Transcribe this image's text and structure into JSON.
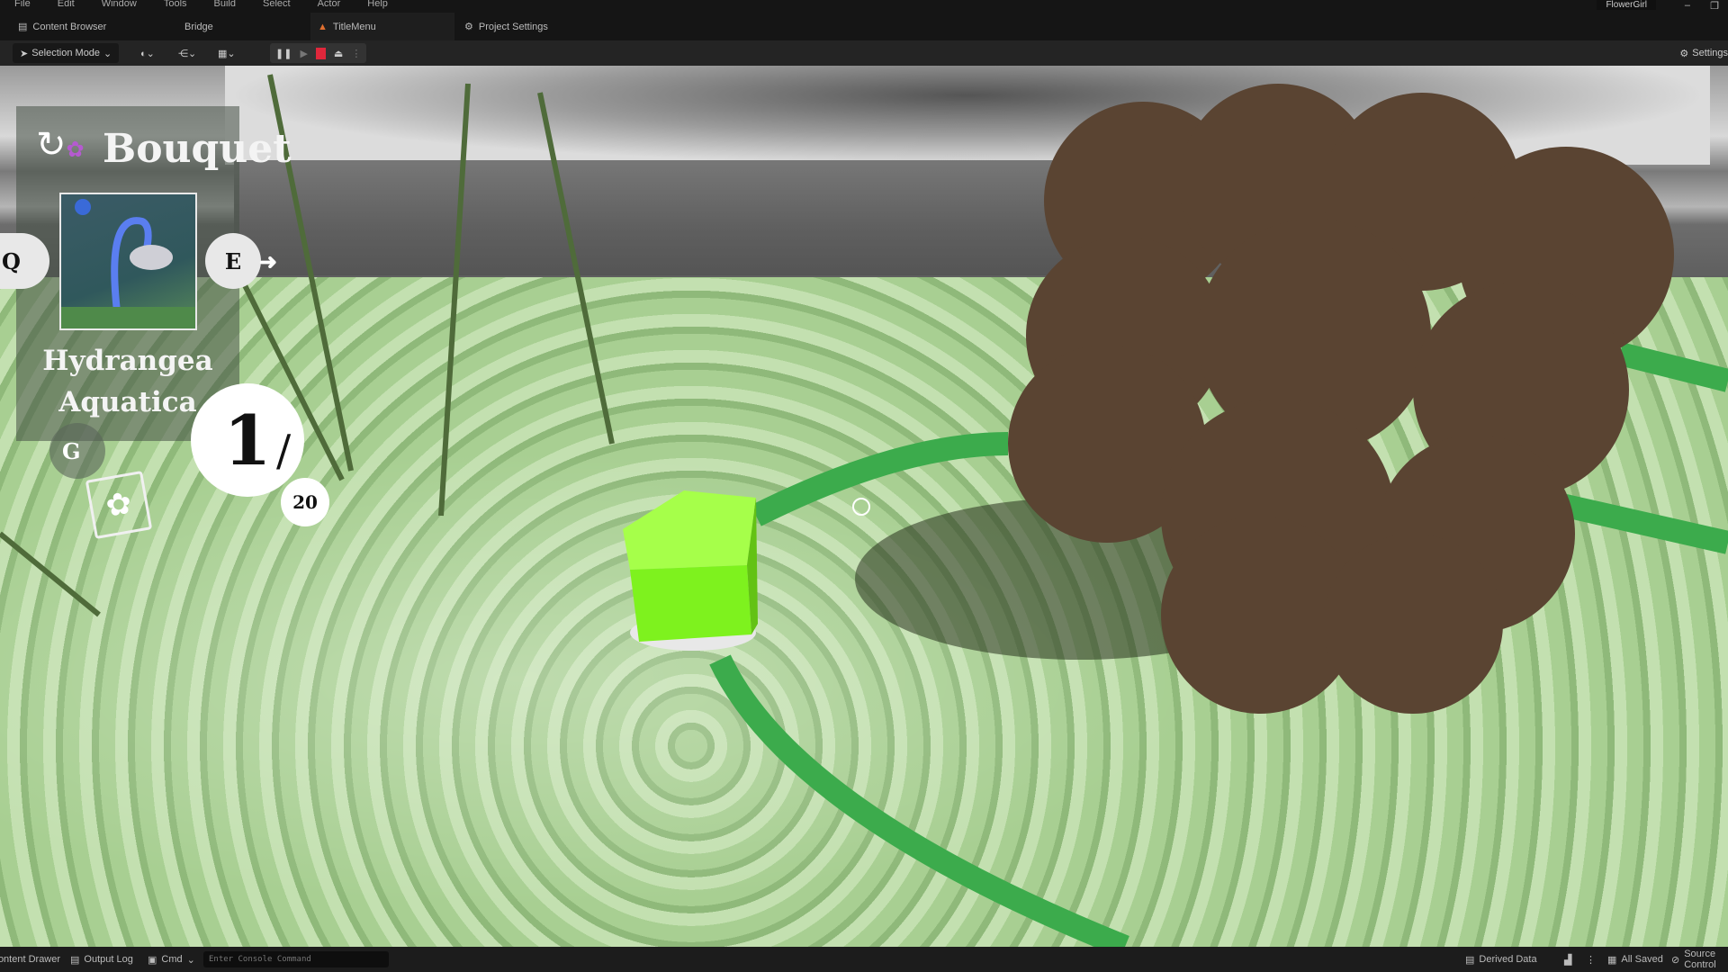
{
  "menu": [
    "File",
    "Edit",
    "Window",
    "Tools",
    "Build",
    "Select",
    "Actor",
    "Help"
  ],
  "tabs": [
    {
      "label": "Content Browser",
      "icon": "folder-icon"
    },
    {
      "label": "Bridge"
    },
    {
      "label": "TitleMenu",
      "icon": "level-icon"
    },
    {
      "label": "Project Settings",
      "icon": "gear-icon"
    }
  ],
  "window": {
    "title": "FlowerGirl",
    "minimize": "–",
    "restore": "❐"
  },
  "toolbar": {
    "selection_mode": "Selection Mode",
    "settings": "Settings",
    "play_state": "playing"
  },
  "hud": {
    "title": "Bouquet",
    "flower_name_line1": "Hydrangea",
    "flower_name_line2": "Aquatica",
    "prev_key": "Q",
    "next_key": "E",
    "book_key": "G",
    "count": "1",
    "slash": "/",
    "total": "20"
  },
  "statusbar": {
    "content_drawer": "Content Drawer",
    "output_log": "Output Log",
    "cmd": "Cmd",
    "console_placeholder": "Enter Console Command",
    "derived_data": "Derived Data",
    "all_saved": "All Saved",
    "source_control": "Source Control"
  },
  "colors": {
    "ring": "#3cab4c",
    "cube": "#7ef21e",
    "dirt": "#5a4432",
    "stop": "#e0273b"
  }
}
